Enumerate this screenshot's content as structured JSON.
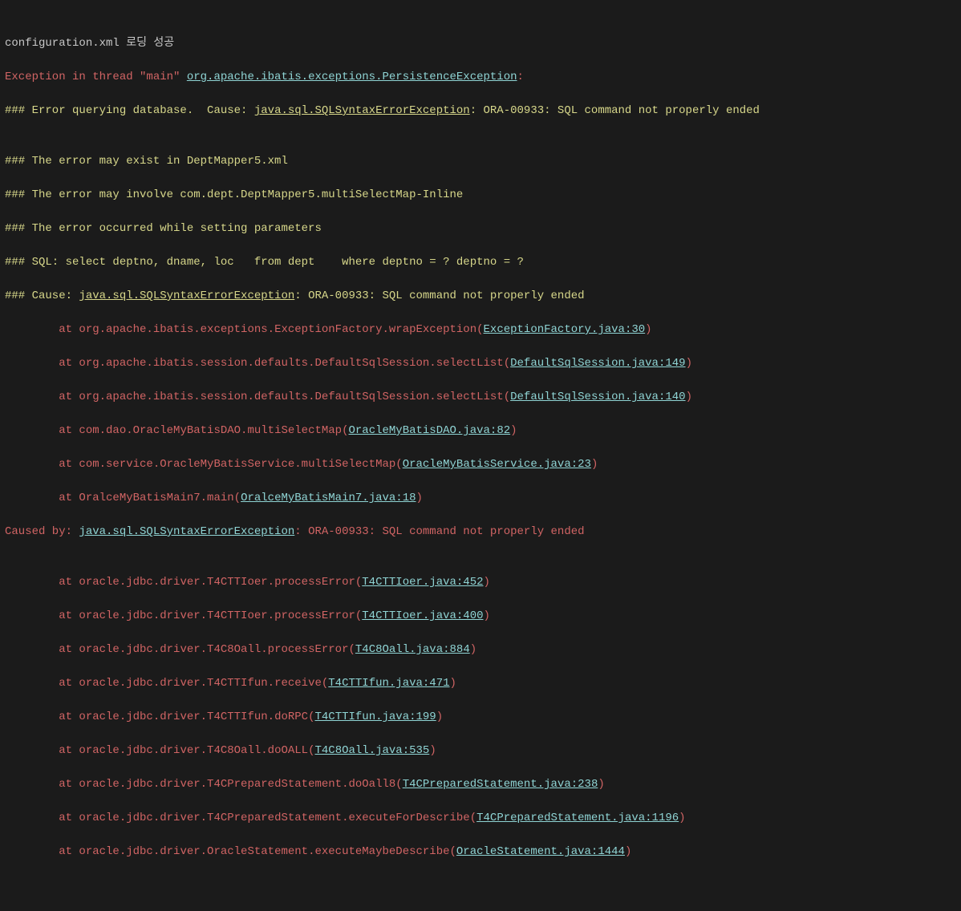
{
  "l1": "configuration.xml 로딩 성공",
  "l2a": "Exception in thread \"main\" ",
  "l2b": "org.apache.ibatis.exceptions.PersistenceException",
  "l2c": ": ",
  "l3a": "### Error querying database.  Cause: ",
  "l3b": "java.sql.SQLSyntaxErrorException",
  "l3c": ": ORA-00933: SQL command not properly ended",
  "l4": "",
  "l5": "### The error may exist in DeptMapper5.xml",
  "l6": "### The error may involve com.dept.DeptMapper5.multiSelectMap-Inline",
  "l7": "### The error occurred while setting parameters",
  "l8": "### SQL: select deptno, dname, loc   from dept    where deptno = ? deptno = ?",
  "l9a": "### Cause: ",
  "l9b": "java.sql.SQLSyntaxErrorException",
  "l9c": ": ORA-00933: SQL command not properly ended",
  "t1a": "\tat org.apache.ibatis.exceptions.ExceptionFactory.wrapException(",
  "t1b": "ExceptionFactory.java:30",
  "t1c": ")",
  "t2a": "\tat org.apache.ibatis.session.defaults.DefaultSqlSession.selectList(",
  "t2b": "DefaultSqlSession.java:149",
  "t2c": ")",
  "t3a": "\tat org.apache.ibatis.session.defaults.DefaultSqlSession.selectList(",
  "t3b": "DefaultSqlSession.java:140",
  "t3c": ")",
  "t4a": "\tat com.dao.OracleMyBatisDAO.multiSelectMap(",
  "t4b": "OracleMyBatisDAO.java:82",
  "t4c": ")",
  "t5a": "\tat com.service.OracleMyBatisService.multiSelectMap(",
  "t5b": "OracleMyBatisService.java:23",
  "t5c": ")",
  "t6a": "\tat OralceMyBatisMain7.main(",
  "t6b": "OralceMyBatisMain7.java:18",
  "t6c": ")",
  "cb1a": "Caused by: ",
  "cb1b": "java.sql.SQLSyntaxErrorException",
  "cb1c": ": ORA-00933: SQL command not properly ended",
  "s1a": "\tat oracle.jdbc.driver.T4CTTIoer.processError(",
  "s1b": "T4CTTIoer.java:452",
  "s1c": ")",
  "s2a": "\tat oracle.jdbc.driver.T4CTTIoer.processError(",
  "s2b": "T4CTTIoer.java:400",
  "s2c": ")",
  "s3a": "\tat oracle.jdbc.driver.T4C8Oall.processError(",
  "s3b": "T4C8Oall.java:884",
  "s3c": ")",
  "s4a": "\tat oracle.jdbc.driver.T4CTTIfun.receive(",
  "s4b": "T4CTTIfun.java:471",
  "s4c": ")",
  "s5a": "\tat oracle.jdbc.driver.T4CTTIfun.doRPC(",
  "s5b": "T4CTTIfun.java:199",
  "s5c": ")",
  "s6a": "\tat oracle.jdbc.driver.T4C8Oall.doOALL(",
  "s6b": "T4C8Oall.java:535",
  "s6c": ")",
  "s7a": "\tat oracle.jdbc.driver.T4CPreparedStatement.doOall8(",
  "s7b": "T4CPreparedStatement.java:238",
  "s7c": ")",
  "s8a": "\tat oracle.jdbc.driver.T4CPreparedStatement.executeForDescribe(",
  "s8b": "T4CPreparedStatement.java:1196",
  "s8c": ")",
  "s9a": "\tat oracle.jdbc.driver.OracleStatement.executeMaybeDescribe(",
  "s9b": "OracleStatement.java:1444",
  "s9c": ")"
}
